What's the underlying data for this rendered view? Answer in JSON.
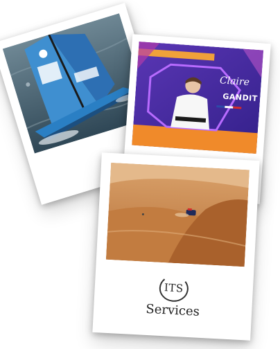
{
  "photos": {
    "sailing": {
      "sail_text": "Sailing Boat"
    },
    "karate": {
      "name_first": "Claire",
      "name_last": "GANDIT"
    },
    "desert": {
      "description_hidden": ""
    }
  },
  "logo": {
    "its": "ITS",
    "services": "Services"
  },
  "colors": {
    "sea": "#3b5566",
    "sail_blue": "#3f8fd0",
    "hull_blue": "#2a7fc4",
    "purple_bg": "#4a2ea0",
    "orange": "#f08a2a",
    "sand": "#c8874a"
  }
}
